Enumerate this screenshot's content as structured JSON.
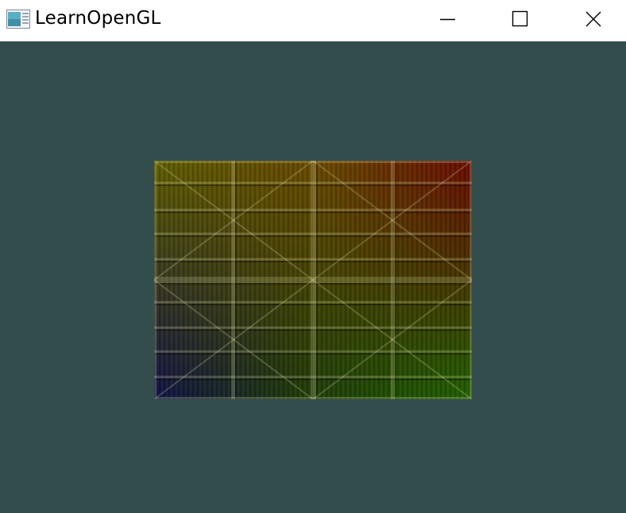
{
  "window": {
    "title": "LearnOpenGL",
    "icon": "app-window-icon",
    "controls": {
      "minimize_icon": "minimize-icon",
      "maximize_icon": "maximize-icon",
      "close_icon": "close-icon"
    }
  },
  "scene": {
    "clear_color": "#334d4d",
    "quad": {
      "texture": "wooden-container-texture",
      "vertex_colors": {
        "top_left": "#ffff00",
        "top_right": "#ff0000",
        "bottom_right": "#00ff00",
        "bottom_left": "#0000ff"
      }
    }
  }
}
